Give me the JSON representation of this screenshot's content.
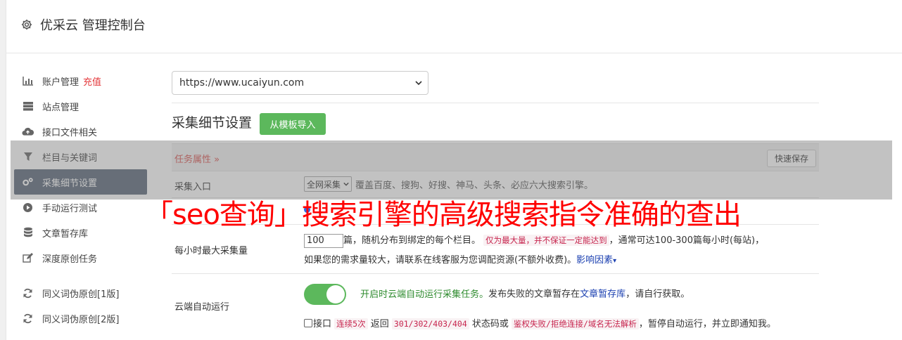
{
  "header": {
    "title": "优采云 管理控制台"
  },
  "sidebar": {
    "items": [
      {
        "label": "账户管理",
        "badge": "充值",
        "icon": "bar-chart-icon"
      },
      {
        "label": "站点管理",
        "icon": "server-icon"
      },
      {
        "label": "接口文件相关",
        "icon": "cloud-upload-icon"
      },
      {
        "label": "栏目与关键词",
        "icon": "filter-icon"
      },
      {
        "label": "采集细节设置",
        "icon": "gears-icon",
        "active": true
      },
      {
        "label": "手动运行测试",
        "icon": "play-circle-icon"
      },
      {
        "label": "文章暂存库",
        "icon": "database-icon"
      },
      {
        "label": "深度原创任务",
        "icon": "edit-icon"
      },
      {
        "label": "同义词伪原创[1版]",
        "icon": "refresh-icon"
      },
      {
        "label": "同义词伪原创[2版]",
        "icon": "refresh-icon"
      }
    ]
  },
  "site_select": {
    "value": "https://www.ucaiyun.com"
  },
  "section": {
    "title": "采集细节设置",
    "import_button": "从模板导入"
  },
  "table": {
    "task_attr": "任务属性 »",
    "quick_save": "快速保存",
    "rows": {
      "entry": {
        "label": "采集入口",
        "select": "全网采集",
        "desc": "覆盖百度、搜狗、好搜、神马、头条、必应六大搜索引擎。"
      },
      "per_hour": {
        "label": "每小时最大采集量",
        "value": "100",
        "t1": "篇，随机分布到绑定的每个栏目。",
        "hl1": "仅为最大量，并不保证一定能达到",
        "t2": "，通常可达100-300篇每小时(每站)，",
        "t3": "如果您的需求量较大，请联系在线客服为您调配资源(不额外收费)。",
        "link": "影响因素"
      },
      "cloud": {
        "label": "云端自动运行",
        "green_text": "开启时云端自动运行采集任务。",
        "t1": "发布失败的文章暂存在",
        "link": "文章暂存库",
        "t2": "，请自行获取。",
        "chk_label": "接口",
        "hl1": "连续5次",
        "t3": "返回",
        "hl2": "301/302/403/404",
        "t4": "状态码或",
        "hl3": "鉴权失败/拒绝连接/域名无法解析",
        "t5": "，暂停自动运行，并立即通知我。"
      }
    }
  },
  "banner": {
    "text": "「seo查询」搜索引擎的高级搜索指令准确的查出"
  },
  "colors": {
    "accent_green": "#5cb85c",
    "active_nav": "#5a6779",
    "banner_red": "#ff0000",
    "highlight_red": "#c7254e"
  }
}
